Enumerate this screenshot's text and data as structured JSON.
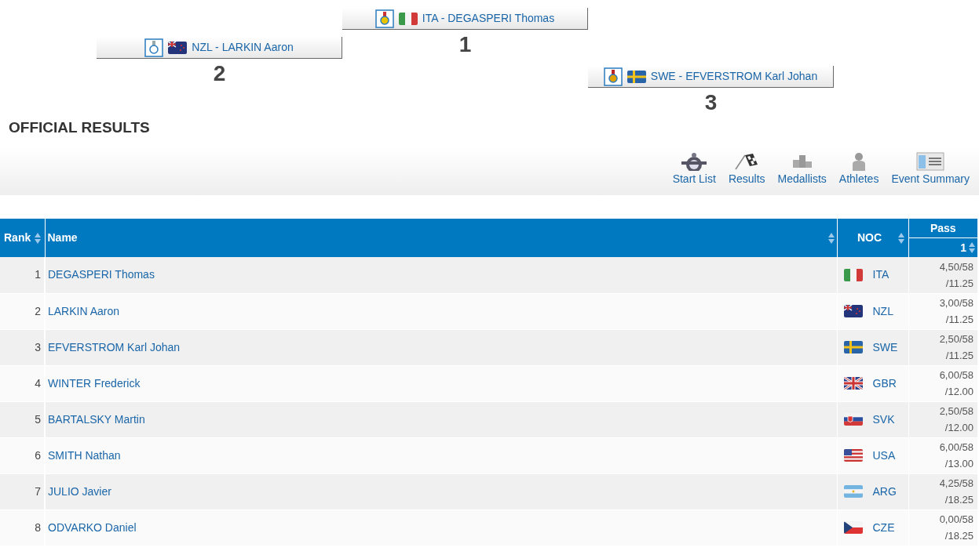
{
  "podium": [
    {
      "place": "2",
      "medal": {
        "kind": "silver"
      },
      "flag": {
        "kind": "nzl"
      },
      "athlete": "NZL - LARKIN Aaron"
    },
    {
      "place": "1",
      "medal": {
        "kind": "gold"
      },
      "flag": {
        "kind": "italy"
      },
      "athlete": "ITA - DEGASPERI Thomas"
    },
    {
      "place": "3",
      "medal": {
        "kind": "bronze"
      },
      "flag": {
        "kind": "sweden"
      },
      "athlete": "SWE - EFVERSTROM Karl Johan"
    }
  ],
  "title": "OFFICIAL RESULTS",
  "toolbar": [
    {
      "kind": "start-list",
      "label": "Start List"
    },
    {
      "kind": "results",
      "label": "Results"
    },
    {
      "kind": "medallists",
      "label": "Medallists"
    },
    {
      "kind": "athletes",
      "label": "Athletes"
    },
    {
      "kind": "summary",
      "label": "Event Summary"
    }
  ],
  "table": {
    "columns": [
      "Rank",
      "Name",
      "NOC",
      "Pass"
    ],
    "subcolumns": [
      "1"
    ],
    "rows": [
      {
        "rank": "1",
        "name": "DEGASPERI Thomas",
        "flag": {
          "kind": "italy"
        },
        "noc": "ITA",
        "pass": [
          "4,50/58",
          "/11.25"
        ]
      },
      {
        "rank": "2",
        "name": "LARKIN Aaron",
        "flag": {
          "kind": "nzl"
        },
        "noc": "NZL",
        "pass": [
          "3,00/58",
          "/11.25"
        ]
      },
      {
        "rank": "3",
        "name": "EFVERSTROM Karl Johan",
        "flag": {
          "kind": "sweden"
        },
        "noc": "SWE",
        "pass": [
          "2,50/58",
          "/11.25"
        ]
      },
      {
        "rank": "4",
        "name": "WINTER Frederick",
        "flag": {
          "kind": "union"
        },
        "noc": "GBR",
        "pass": [
          "6,00/58",
          "/12.00"
        ]
      },
      {
        "rank": "5",
        "name": "BARTALSKY Martin",
        "flag": {
          "kind": "slovakia"
        },
        "noc": "SVK",
        "pass": [
          "2,50/58",
          "/12.00"
        ]
      },
      {
        "rank": "6",
        "name": "SMITH Nathan",
        "flag": {
          "kind": "usa"
        },
        "noc": "USA",
        "pass": [
          "6,00/58",
          "/13.00"
        ]
      },
      {
        "rank": "7",
        "name": "JULIO Javier",
        "flag": {
          "kind": "argentina"
        },
        "noc": "ARG",
        "pass": [
          "4,25/58",
          "/18.25"
        ]
      },
      {
        "rank": "8",
        "name": "ODVARKO Daniel",
        "flag": {
          "kind": "czech"
        },
        "noc": "CZE",
        "pass": [
          "0,00/58",
          "/18.25"
        ]
      }
    ]
  }
}
